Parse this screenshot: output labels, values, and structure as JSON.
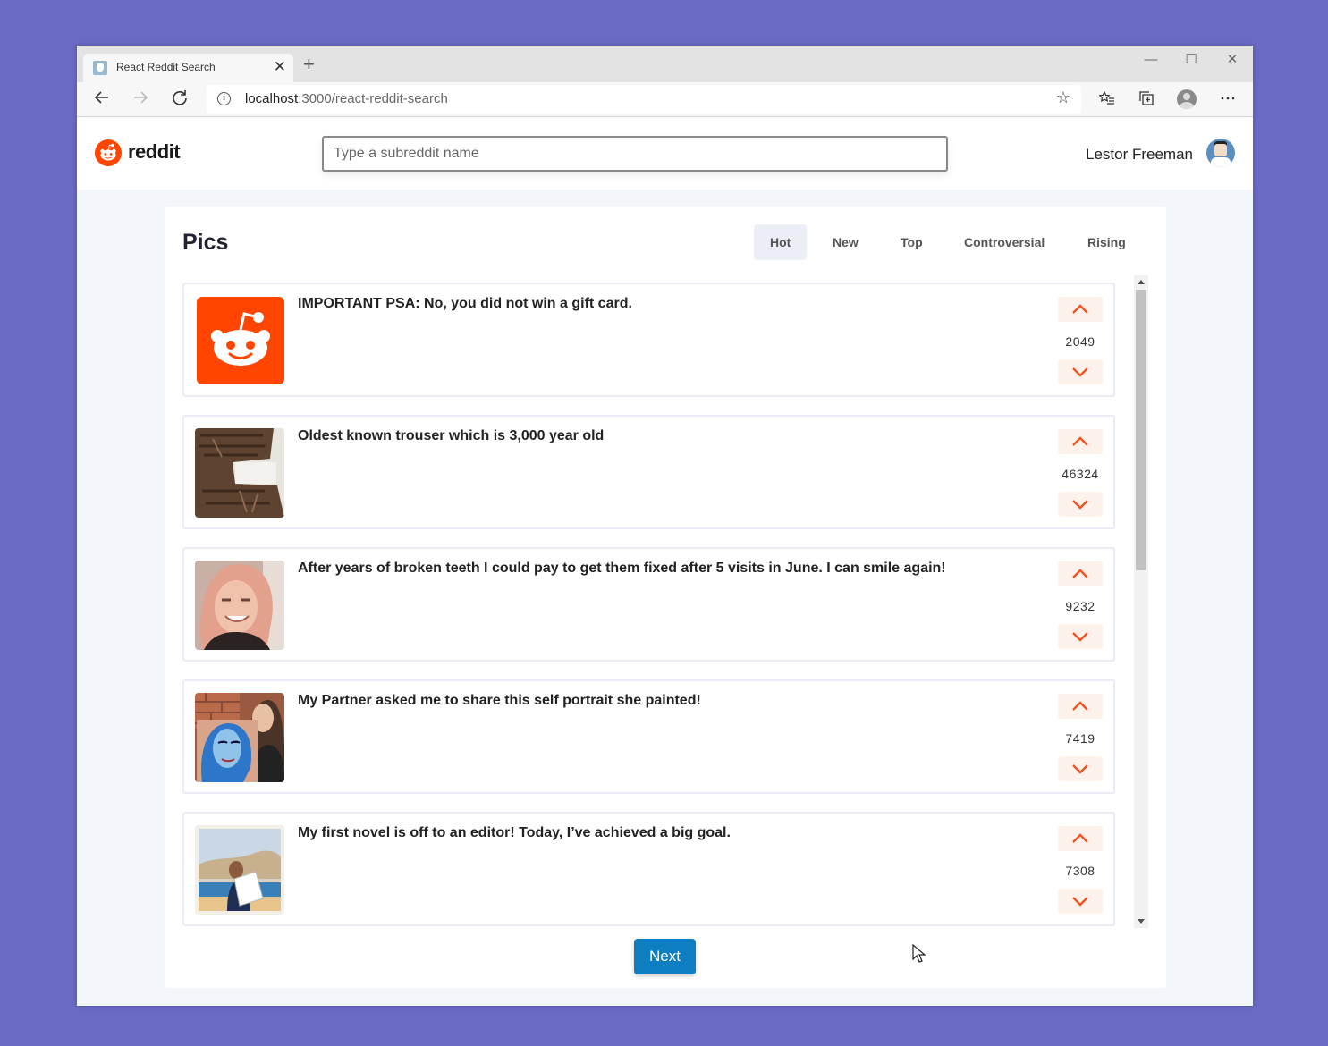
{
  "browser": {
    "tab_title": "React Reddit Search",
    "tab_close": "✕",
    "new_tab": "+",
    "url_host": "localhost",
    "url_path": ":3000/react-reddit-search",
    "win_min": "—",
    "win_max": "☐",
    "win_close": "✕"
  },
  "header": {
    "logo_text": "reddit",
    "search_placeholder": "Type a subreddit name",
    "search_value": "",
    "username": "Lestor Freeman"
  },
  "subreddit": {
    "title": "Pics",
    "sort_tabs": [
      {
        "label": "Hot",
        "active": true
      },
      {
        "label": "New",
        "active": false
      },
      {
        "label": "Top",
        "active": false
      },
      {
        "label": "Controversial",
        "active": false
      },
      {
        "label": "Rising",
        "active": false
      }
    ]
  },
  "posts": [
    {
      "title": "IMPORTANT PSA: No, you did not win a gift card.",
      "score": "2049",
      "thumbnail": "reddit-logo"
    },
    {
      "title": "Oldest known trouser which is 3,000 year old",
      "score": "46324",
      "thumbnail": "trouser-photo"
    },
    {
      "title": "After years of broken teeth I could pay to get them fixed after 5 visits in June. I can smile again!",
      "score": "9232",
      "thumbnail": "smiling-woman-photo"
    },
    {
      "title": "My Partner asked me to share this self portrait she painted!",
      "score": "7419",
      "thumbnail": "portrait-painting-photo"
    },
    {
      "title": "My first novel is off to an editor! Today, I’ve achieved a big goal.",
      "score": "7308",
      "thumbnail": "novel-author-photo"
    }
  ],
  "pagination": {
    "next_label": "Next"
  },
  "colors": {
    "accent": "#ff4500",
    "button": "#0d7ec2",
    "background": "#6b6bc6"
  }
}
